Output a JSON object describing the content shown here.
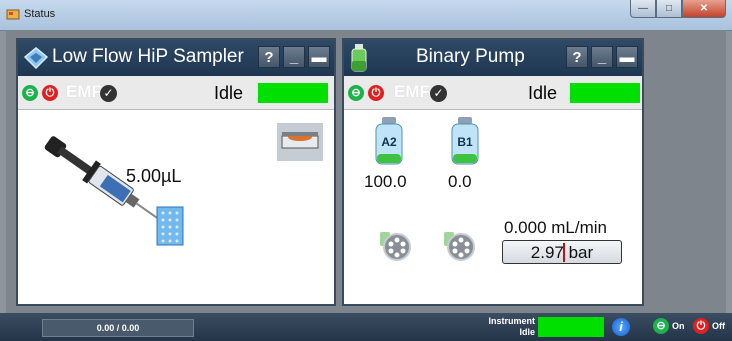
{
  "window": {
    "title": "Status"
  },
  "sampler": {
    "title": "Low Flow HiP Sampler",
    "help_label": "?",
    "emf_label": "EMF",
    "on_label": "⊖",
    "off_label": "⏻",
    "state_label": "Idle",
    "state_color": "#00e000",
    "volume": "5.00µL"
  },
  "pump": {
    "title": "Binary Pump",
    "help_label": "?",
    "emf_label": "EMF",
    "on_label": "⊖",
    "off_label": "⏻",
    "state_label": "Idle",
    "state_color": "#00e000",
    "bottle_a_label": "A2",
    "bottle_b_label": "B1",
    "bottle_a_value": "100.0",
    "bottle_b_value": "0.0",
    "flow": "0.000 mL/min",
    "pressure": "2.97 bar"
  },
  "footer": {
    "progress": "0.00 / 0.00",
    "instrument_label": "Instrument",
    "instrument_state": "Idle",
    "on_label": "On",
    "off_label": "Off",
    "info_label": "i"
  }
}
